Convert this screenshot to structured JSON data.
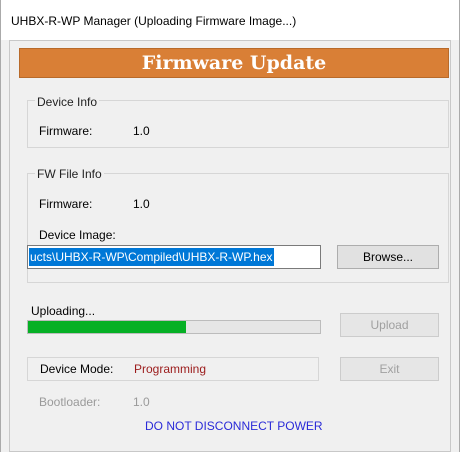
{
  "window": {
    "title": "UHBX-R-WP Manager (Uploading Firmware Image...)"
  },
  "header": {
    "title": "Firmware Update"
  },
  "device_info": {
    "legend": "Device Info",
    "firmware_label": "Firmware:",
    "firmware_value": "1.0"
  },
  "fw_file_info": {
    "legend": "FW File Info",
    "firmware_label": "Firmware:",
    "firmware_value": "1.0",
    "device_image_label": "Device Image:",
    "device_image_path": "ucts\\UHBX-R-WP\\Compiled\\UHBX-R-WP.hex",
    "browse_label": "Browse..."
  },
  "upload": {
    "status_label": "Uploading...",
    "progress_fraction": 0.54,
    "upload_label": "Upload"
  },
  "device_mode": {
    "label": "Device Mode:",
    "value": "Programming",
    "exit_label": "Exit"
  },
  "bootloader": {
    "label": "Bootloader:",
    "value": "1.0"
  },
  "warning": "DO NOT DISCONNECT POWER",
  "colors": {
    "header_bg": "#d97f36",
    "progress": "#06b025",
    "selection": "#0078d7",
    "mode_value": "#9b1b1b",
    "warning": "#2a2ad8"
  }
}
